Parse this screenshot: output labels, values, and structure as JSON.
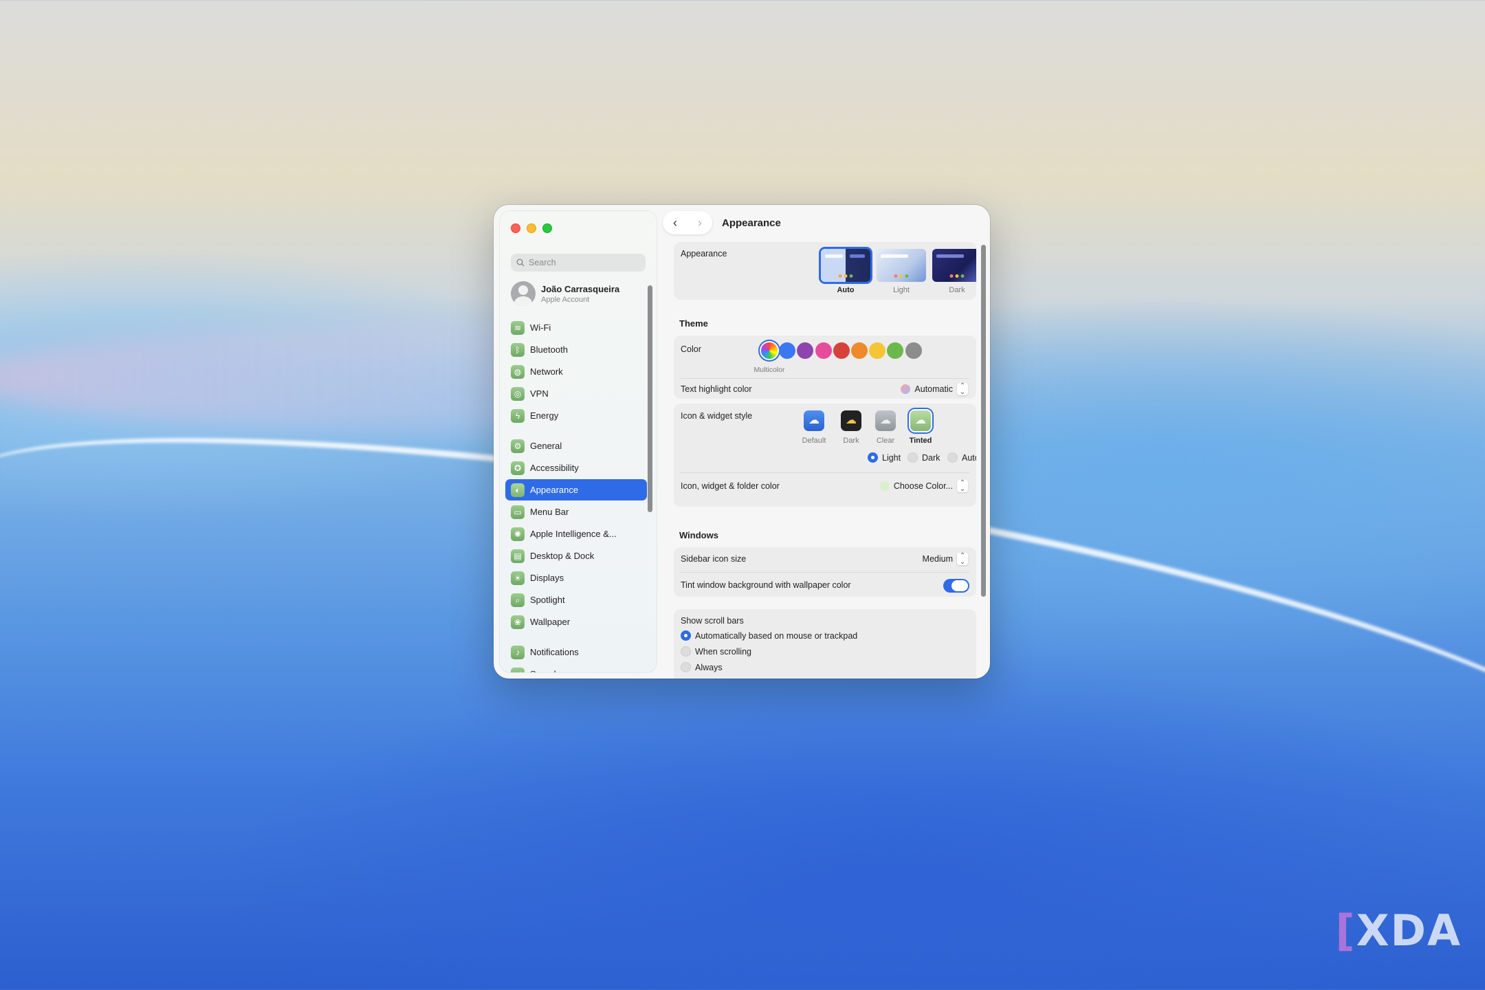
{
  "window": {
    "title": "Appearance"
  },
  "sidebar": {
    "search_placeholder": "Search",
    "account": {
      "name": "João Carrasqueira",
      "subtitle": "Apple Account"
    },
    "groups": [
      [
        {
          "label": "Wi-Fi",
          "icon": "wifi-icon",
          "glyph": "≋"
        },
        {
          "label": "Bluetooth",
          "icon": "bluetooth-icon",
          "glyph": "ᛒ"
        },
        {
          "label": "Network",
          "icon": "globe-icon",
          "glyph": "◍"
        },
        {
          "label": "VPN",
          "icon": "vpn-icon",
          "glyph": "◎"
        },
        {
          "label": "Energy",
          "icon": "bolt-icon",
          "glyph": "ϟ"
        }
      ],
      [
        {
          "label": "General",
          "icon": "gear-icon",
          "glyph": "⚙"
        },
        {
          "label": "Accessibility",
          "icon": "accessibility-icon",
          "glyph": "✪"
        },
        {
          "label": "Appearance",
          "icon": "appearance-icon",
          "glyph": "◐",
          "active": true
        },
        {
          "label": "Menu Bar",
          "icon": "menubar-icon",
          "glyph": "▭"
        },
        {
          "label": "Apple Intelligence &...",
          "icon": "sparkle-icon",
          "glyph": "✺"
        },
        {
          "label": "Desktop & Dock",
          "icon": "dock-icon",
          "glyph": "▤"
        },
        {
          "label": "Displays",
          "icon": "sun-icon",
          "glyph": "☀"
        },
        {
          "label": "Spotlight",
          "icon": "magnifier-icon",
          "glyph": "⌕"
        },
        {
          "label": "Wallpaper",
          "icon": "flower-icon",
          "glyph": "❀"
        }
      ],
      [
        {
          "label": "Notifications",
          "icon": "bell-icon",
          "glyph": "♪"
        },
        {
          "label": "Sound",
          "icon": "speaker-icon",
          "glyph": "◀"
        }
      ]
    ]
  },
  "appearance": {
    "label": "Appearance",
    "options": [
      {
        "label": "Auto",
        "selected": true
      },
      {
        "label": "Light",
        "selected": false
      },
      {
        "label": "Dark",
        "selected": false
      }
    ]
  },
  "theme": {
    "heading": "Theme",
    "color_label": "Color",
    "selected_color_label": "Multicolor",
    "colors": [
      "multicolor",
      "#3b78f0",
      "#8e44ad",
      "#e64c9b",
      "#d6423a",
      "#ee8a2a",
      "#f5c535",
      "#6cb84d",
      "#8c8c8c"
    ],
    "highlight_label": "Text highlight color",
    "highlight_value": "Automatic"
  },
  "icon_style": {
    "label": "Icon & widget style",
    "options": [
      {
        "label": "Default",
        "selected": false
      },
      {
        "label": "Dark",
        "selected": false
      },
      {
        "label": "Clear",
        "selected": false
      },
      {
        "label": "Tinted",
        "selected": true
      }
    ],
    "modes": [
      {
        "label": "Light",
        "selected": true
      },
      {
        "label": "Dark",
        "selected": false
      },
      {
        "label": "Auto",
        "selected": false
      }
    ],
    "folder_label": "Icon, widget & folder color",
    "folder_value": "Choose Color..."
  },
  "windows": {
    "heading": "Windows",
    "sidebar_icon_label": "Sidebar icon size",
    "sidebar_icon_value": "Medium",
    "tint_label": "Tint window background with wallpaper color",
    "tint_on": true
  },
  "scroll_bars": {
    "label": "Show scroll bars",
    "options": [
      {
        "label": "Automatically based on mouse or trackpad",
        "selected": true
      },
      {
        "label": "When scrolling",
        "selected": false
      },
      {
        "label": "Always",
        "selected": false
      }
    ]
  },
  "watermark": "XDA",
  "colors": {
    "accent": "#2f6be6"
  }
}
